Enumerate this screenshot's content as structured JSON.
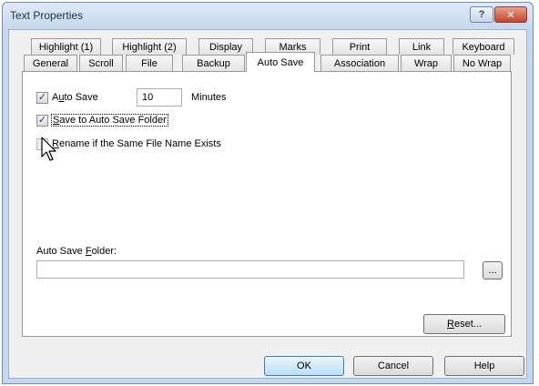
{
  "window": {
    "title": "Text Properties",
    "help_glyph": "?",
    "close_glyph": "✕"
  },
  "tabs": {
    "row1": [
      "Highlight (1)",
      "Highlight (2)",
      "Display",
      "Marks",
      "Print",
      "Link",
      "Keyboard"
    ],
    "row2": [
      "General",
      "Scroll",
      "File",
      "Backup",
      "Auto Save",
      "Association",
      "Wrap",
      "No Wrap"
    ],
    "selected": "Auto Save"
  },
  "panel": {
    "auto_save": {
      "checked": true,
      "label_pre": "A",
      "label_access": "u",
      "label_post": "to Save",
      "minutes_value": "10",
      "minutes_label": "Minutes"
    },
    "save_folder": {
      "checked": true,
      "label_access": "S",
      "label_post": "ave to Auto Save Folder"
    },
    "rename": {
      "checked": false,
      "enabled": false,
      "label_access": "R",
      "label_post": "ename if the Same File Name Exists"
    },
    "folder": {
      "label_pre": "Auto Save ",
      "label_access": "F",
      "label_post": "older:",
      "value": "",
      "browse_label": "..."
    },
    "reset": {
      "label_access": "R",
      "label_post": "eset..."
    }
  },
  "footer": {
    "ok": "OK",
    "cancel": "Cancel",
    "help": "Help"
  },
  "check_glyph": "✓"
}
